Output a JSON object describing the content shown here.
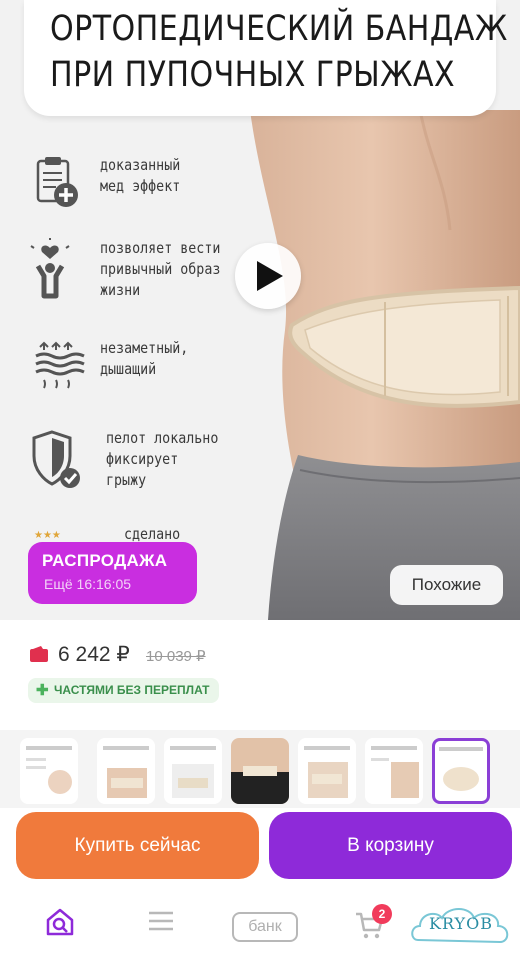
{
  "hero": {
    "title_line1": "ортопедический бандаж",
    "title_line2": "при пупочных грыжах",
    "features": [
      {
        "icon": "clipboard-medical-icon",
        "line1": "доказанный",
        "line2": "мед эффект",
        "line3": ""
      },
      {
        "icon": "active-person-heart-icon",
        "line1": "позволяет вести",
        "line2": "привычный образ",
        "line3": "жизни"
      },
      {
        "icon": "breathable-layers-icon",
        "line1": "незаметный,",
        "line2": "дышащий",
        "line3": ""
      },
      {
        "icon": "shield-check-icon",
        "line1": "пелот локально",
        "line2": "фиксирует",
        "line3": "грыжу"
      },
      {
        "icon": "stars-icon",
        "line1": "сделано",
        "line2": "",
        "line3": ""
      }
    ],
    "play_icon": "play-icon",
    "sale_label": "РАСПРОДАЖА",
    "sale_timer": "Ещё 16:16:05",
    "similar_label": "Похожие"
  },
  "price": {
    "current": "6 242 ₽",
    "old": "10 039 ₽",
    "installment": "ЧАСТЯМИ БЕЗ ПЕРЕПЛАТ",
    "icon": "wallet-icon"
  },
  "actions": {
    "buy_now": "Купить сейчас",
    "add_to_cart": "В корзину"
  },
  "nav": {
    "home_icon": "home-search-icon",
    "catalog_icon": "menu-icon",
    "bank_label": "банк",
    "cart_icon": "cart-icon",
    "cart_count": "2"
  },
  "watermark": "KRYOB",
  "colors": {
    "sale": "#c92ee0",
    "buy_now": "#f07a3c",
    "add_to_cart": "#8e2ad9",
    "price_icon": "#e0304e",
    "installment": "#3a8f4c",
    "cart_badge": "#f13b5b"
  }
}
